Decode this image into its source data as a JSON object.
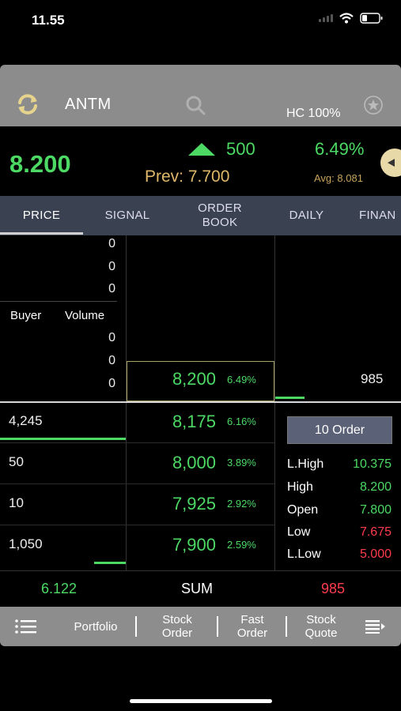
{
  "status": {
    "time": "11.55"
  },
  "header": {
    "ticker": "ANTM",
    "hc_label": "HC 100%"
  },
  "quote": {
    "last": "8.200",
    "change": "500",
    "prev": "Prev: 7.700",
    "pct": "6.49%",
    "avg": "Avg: 8.081"
  },
  "tabs": [
    {
      "label": "PRICE",
      "active": true
    },
    {
      "label": "SIGNAL"
    },
    {
      "label": "ORDER BOOK"
    },
    {
      "label": "DAILY"
    },
    {
      "label": "FINAN"
    }
  ],
  "order_book": {
    "top_zeros": [
      "0",
      "0",
      "0"
    ],
    "header": {
      "buyer": "Buyer",
      "volume": "Volume"
    },
    "lower_zeros": [
      "0",
      "0",
      "0"
    ],
    "current": {
      "price": "8,200",
      "pct": "6.49%",
      "volume": "985"
    },
    "bids": [
      {
        "vol": "4,245",
        "price": "8,175",
        "pct": "6.16%"
      },
      {
        "vol": "50",
        "price": "8,000",
        "pct": "3.89%"
      },
      {
        "vol": "10",
        "price": "7,925",
        "pct": "2.92%"
      },
      {
        "vol": "1,050",
        "price": "7,900",
        "pct": "2.59%"
      }
    ]
  },
  "order_button": "10 Order",
  "stats": [
    {
      "label": "L.High",
      "value": "10.375",
      "color": "#4cd964"
    },
    {
      "label": "High",
      "value": "8.200",
      "color": "#4cd964"
    },
    {
      "label": "Open",
      "value": "7.800",
      "color": "#4cd964"
    },
    {
      "label": "Low",
      "value": "7.675",
      "color": "#ff3b4e"
    },
    {
      "label": "L.Low",
      "value": "5.000",
      "color": "#ff3b4e"
    }
  ],
  "sum": {
    "left": "6.122",
    "label": "SUM",
    "right": "985"
  },
  "bottom_nav": {
    "portfolio": "Portfolio",
    "stock_order": [
      "Stock",
      "Order"
    ],
    "fast_order": [
      "Fast",
      "Order"
    ],
    "stock_quote": [
      "Stock",
      "Quote"
    ]
  },
  "colors": {
    "up": "#4cd964",
    "down": "#ff3b4e",
    "accent": "#e0b86a"
  }
}
